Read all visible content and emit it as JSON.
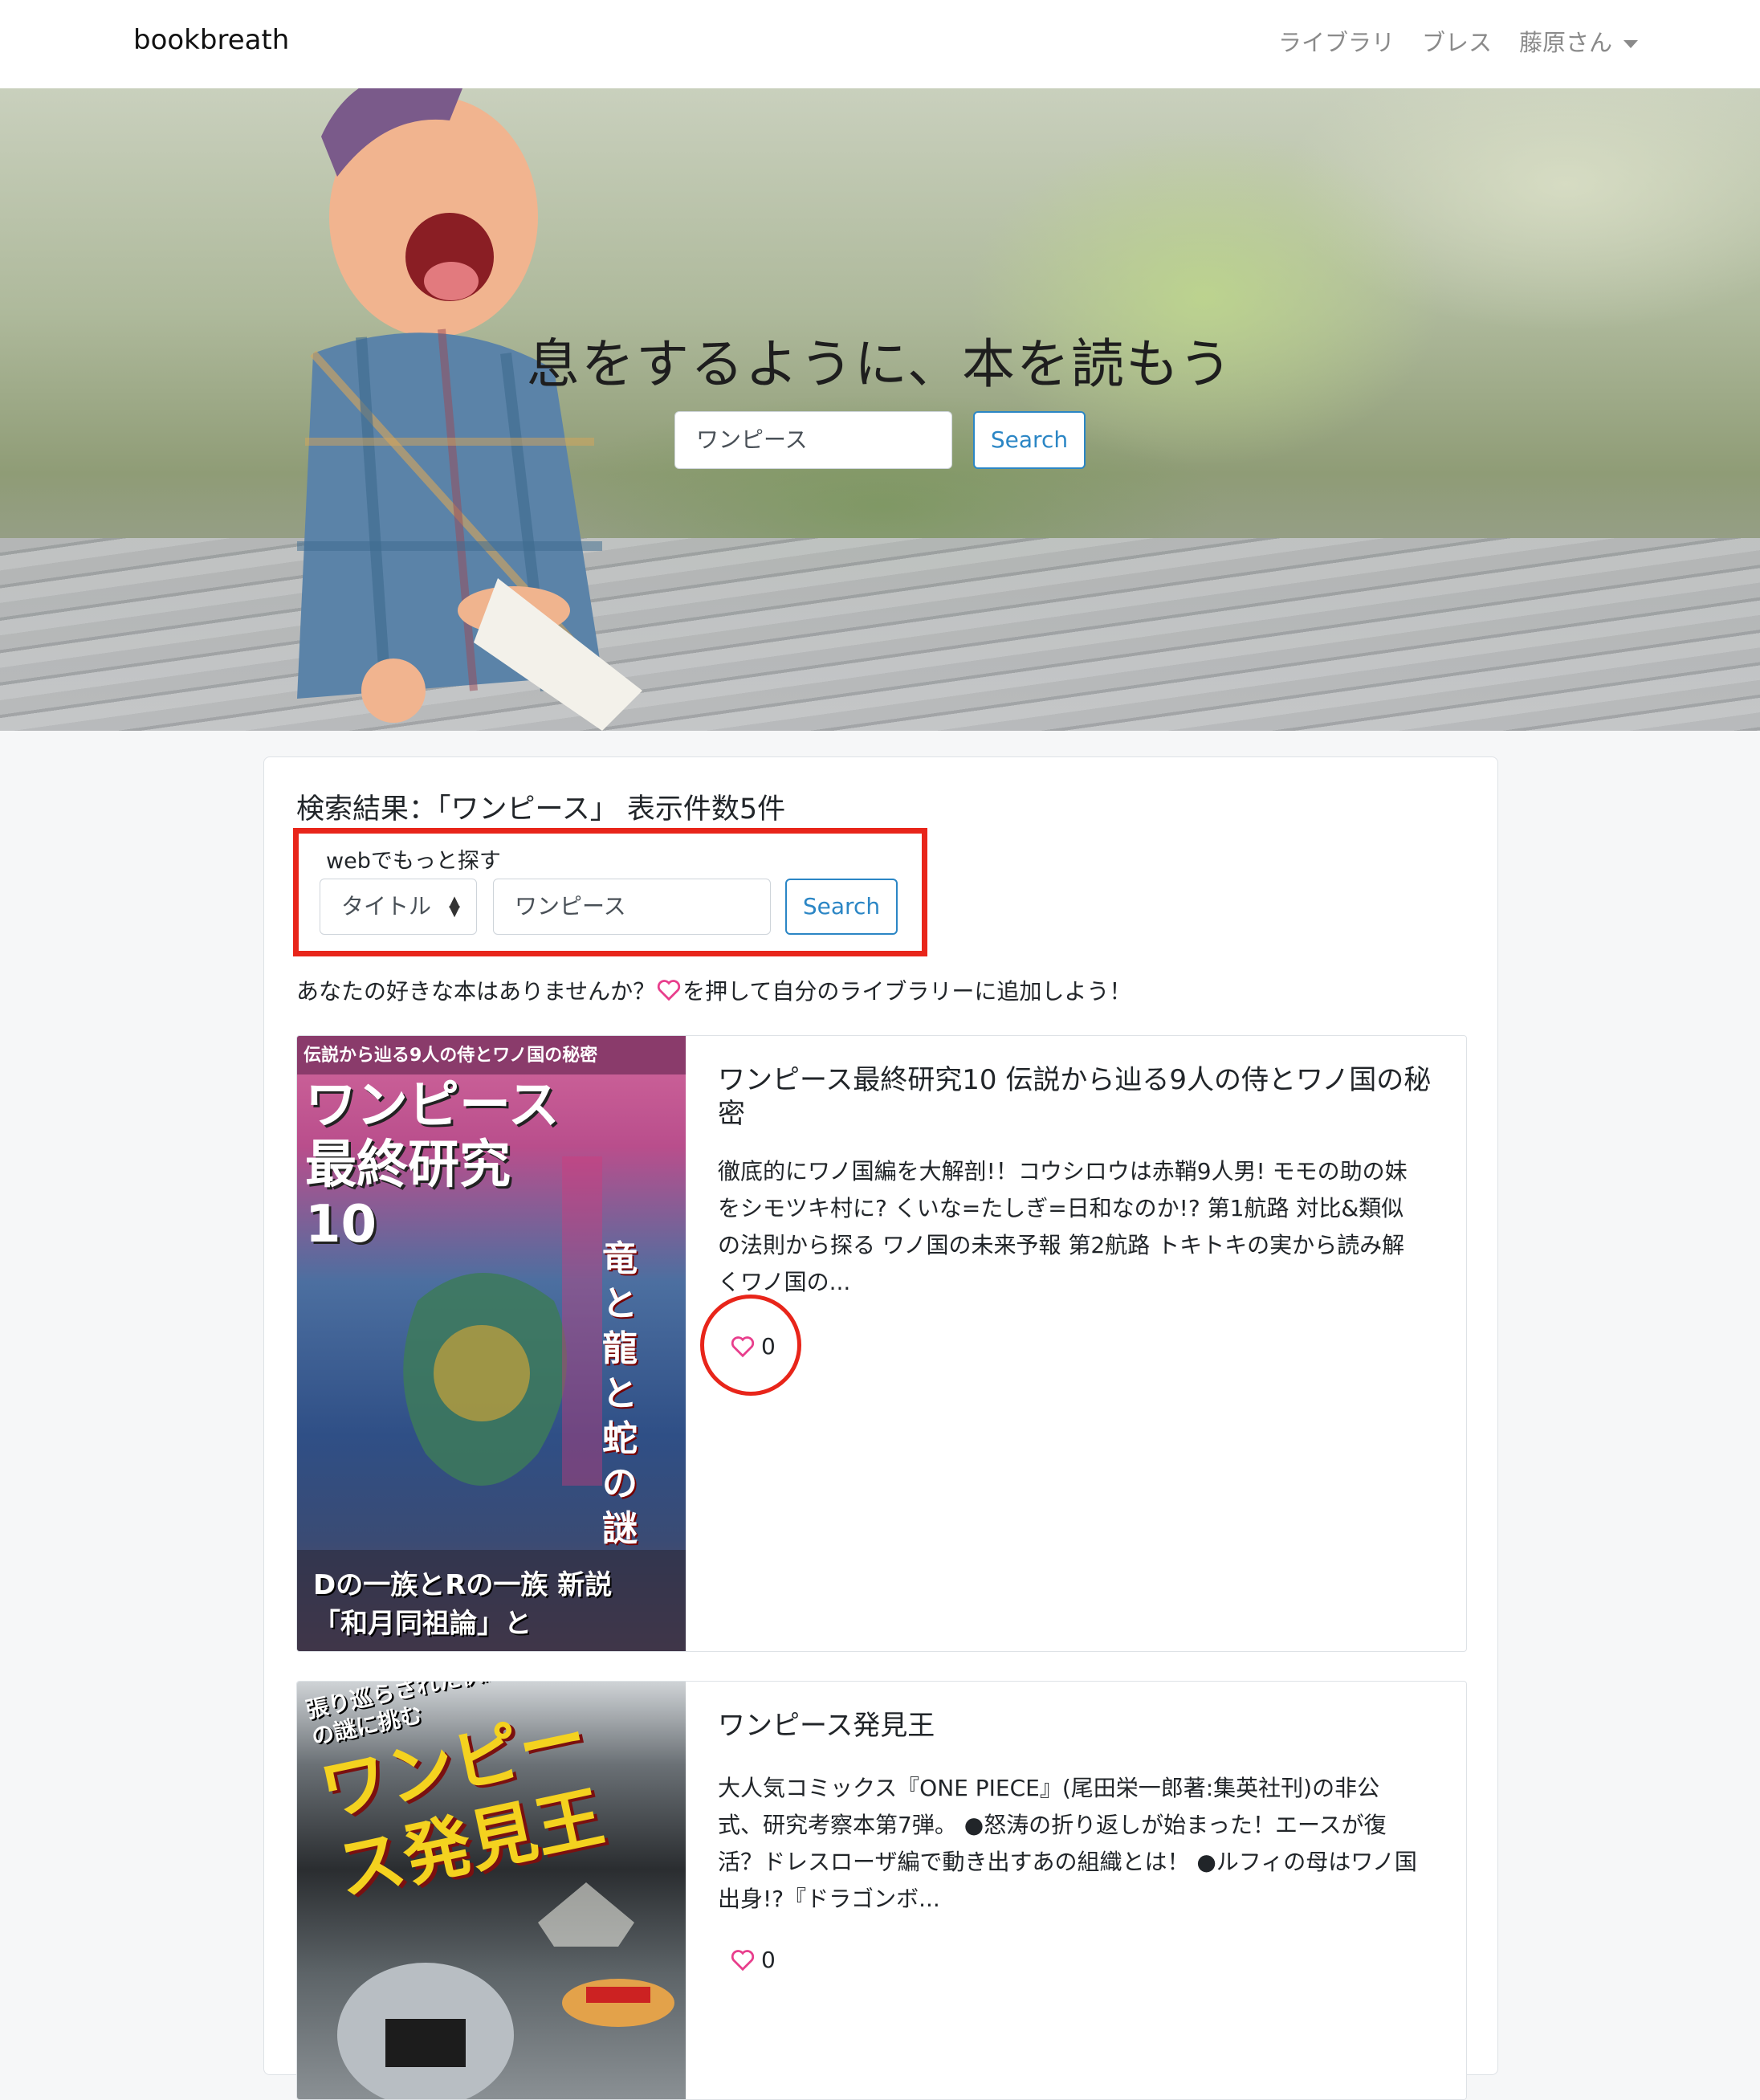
{
  "navbar": {
    "brand": "bookbreath",
    "links": [
      "ライブラリ",
      "ブレス"
    ],
    "user": "藤原さん"
  },
  "hero": {
    "title": "息をするように、本を読もう",
    "search_value": "ワンピース",
    "search_button": "Search"
  },
  "results": {
    "heading": "検索結果：「ワンピース」 表示件数5件",
    "web_label": "webでもっと探す",
    "select_value": "タイトル",
    "web_search_value": "ワンピース",
    "web_search_button": "Search",
    "hint_before": "あなたの好きな本はありませんか？",
    "hint_after": "を押して自分のライブラリーに追加しよう！",
    "books": [
      {
        "title": "ワンピース最終研究10 伝説から辿る9人の侍とワノ国の秘密",
        "description": "徹底的にワノ国編を大解剖!！コウシロウは赤鞘9人男! モモの助の妹をシモツキ村に? くいな=たしぎ=日和なのか!? 第1航路 対比&類似の法則から探る ワノ国の未来予報 第2航路 トキトキの実から読み解くワノ国の...",
        "likes": "0",
        "cover_text_top": "伝説から辿る9人の侍とワノ国の秘密",
        "cover_text_title": "ワンピース最終研究10",
        "cover_text_sub": "竜と龍と蛇の謎",
        "cover_text_bottom": "Dの一族とRの一族 新説「和月同祖論」と"
      },
      {
        "title": "ワンピース発見王",
        "description": "大人気コミックス『ONE PIECE』(尾田栄一郎著:集英社刊)の非公式、研究考察本第7弾。 ●怒涛の折り返しが始まった！エースが復活？ドレスローザ編で動き出すあの組織とは！ ●ルフィの母はワノ国出身!?『ドラゴンボ...",
        "likes": "0",
        "cover_text_top": "張り巡らされた伏線パズルの謎に挑む",
        "cover_text_title": "ワンピース発見王"
      }
    ]
  },
  "colors": {
    "accent": "#2b86c5",
    "highlight_red": "#e8251a",
    "heart_pink": "#e83e8c"
  }
}
